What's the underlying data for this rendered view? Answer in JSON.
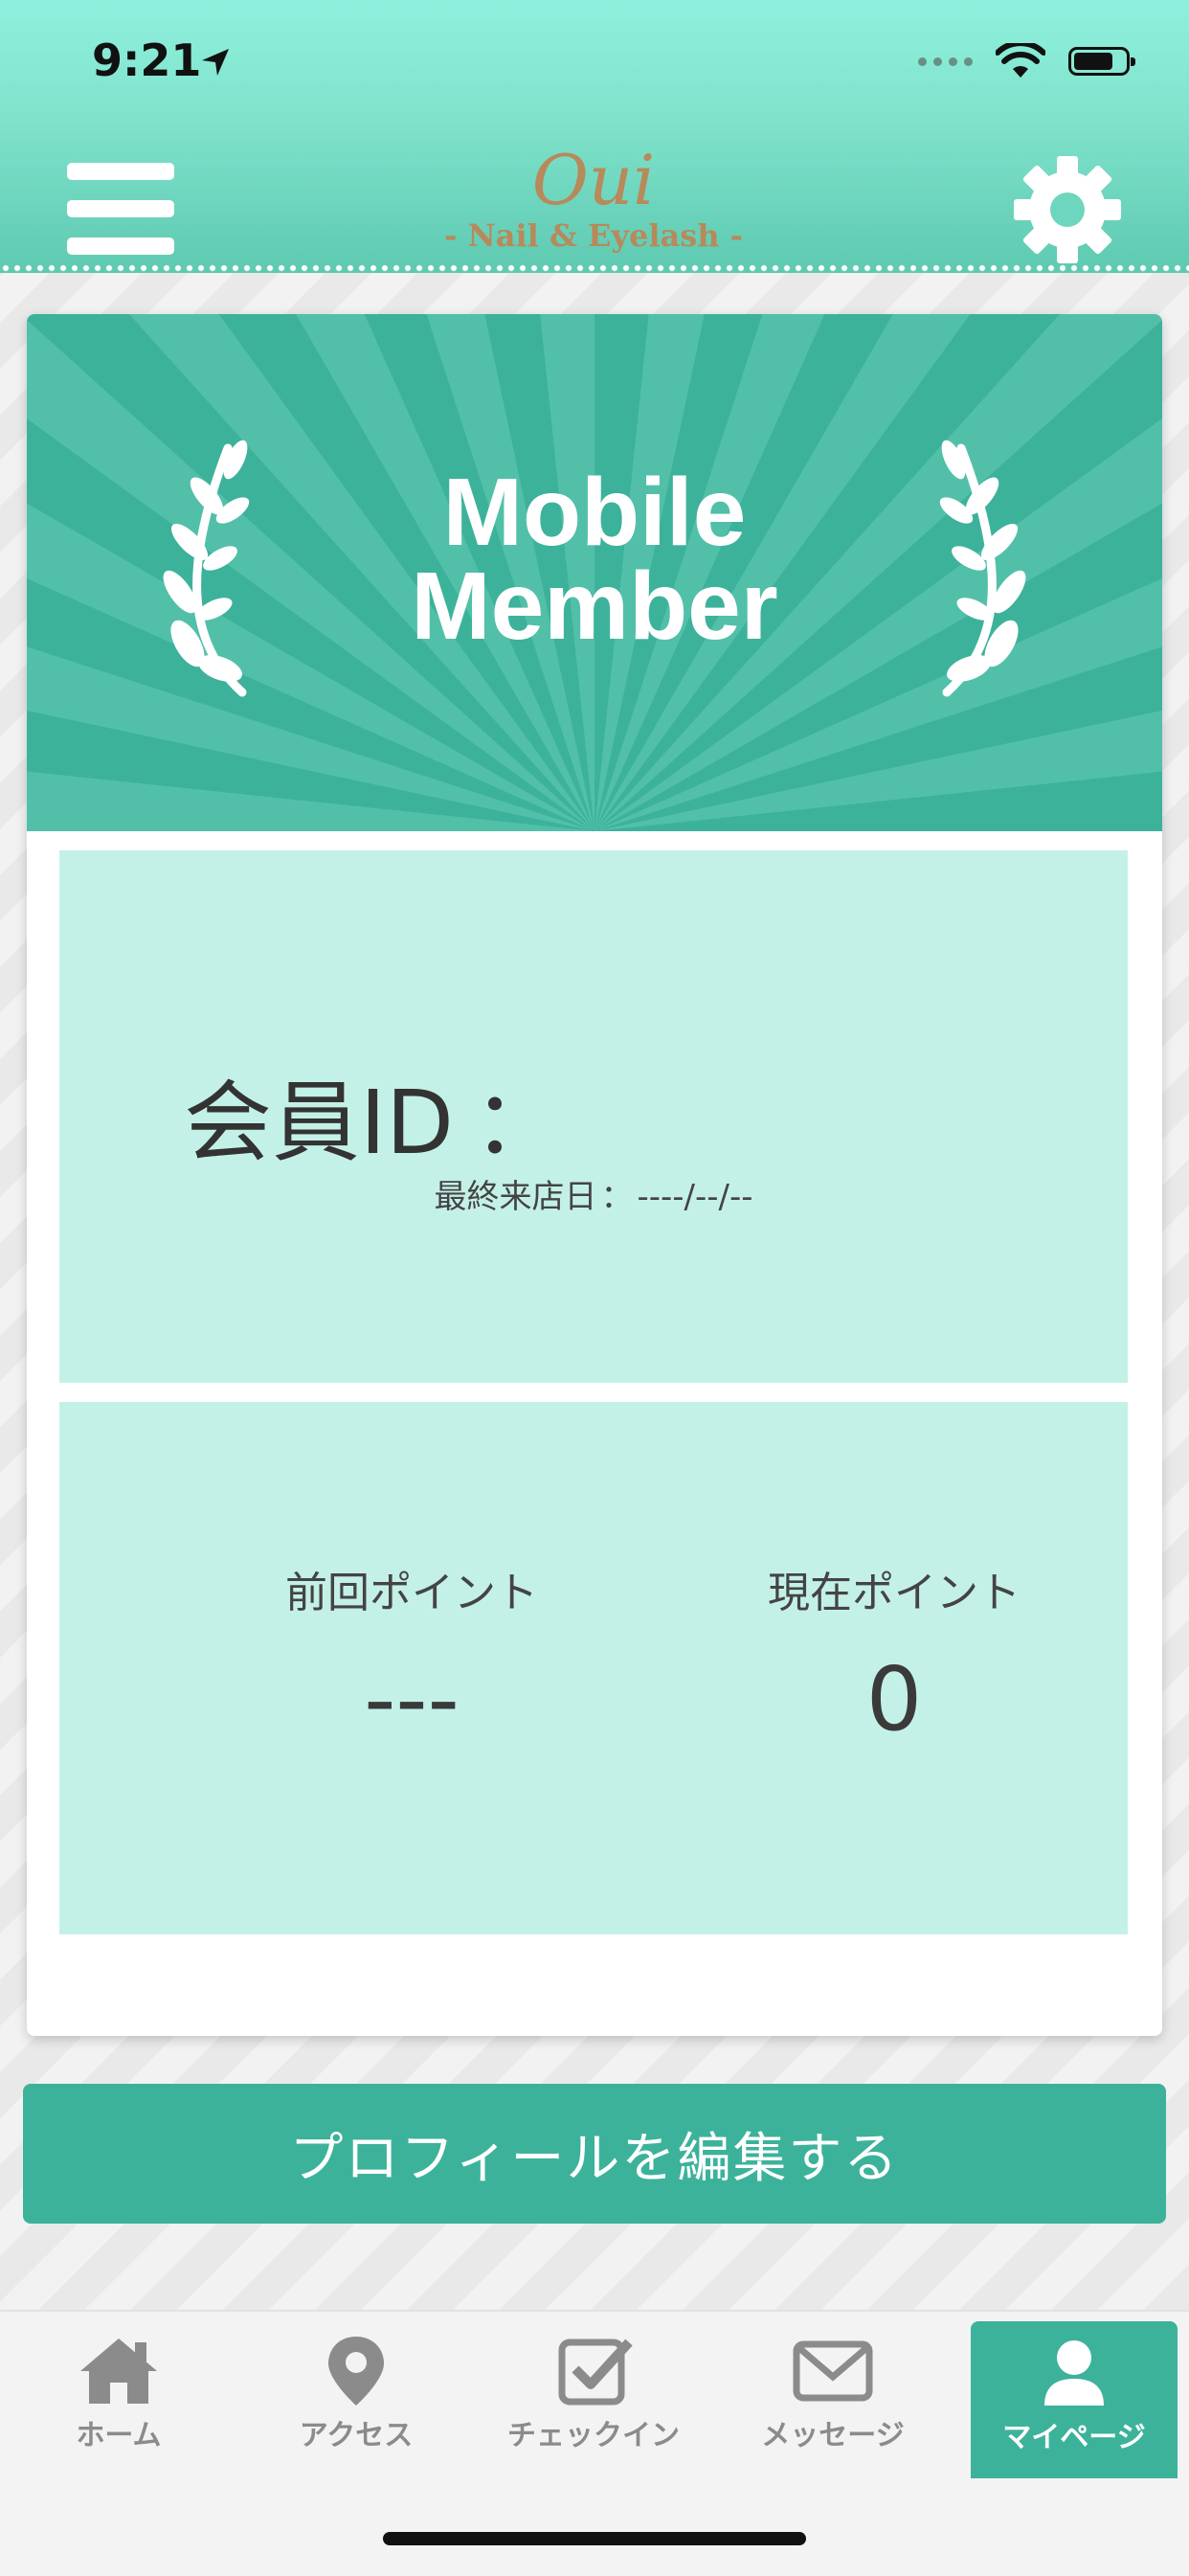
{
  "status_bar": {
    "time": "9:21"
  },
  "header": {
    "logo_main": "Oui",
    "logo_sub": "- Nail & Eyelash -",
    "menu_icon": "hamburger-icon",
    "settings_icon": "gear-icon"
  },
  "card": {
    "banner_line1": "Mobile",
    "banner_line2": "Member",
    "member_id_label": "会員ID",
    "member_id_colon": "：",
    "last_visit_label": "最終来店日",
    "last_visit_sep": "：",
    "last_visit_value": "----/--/--",
    "previous_points_label": "前回ポイント",
    "previous_points_value": "---",
    "current_points_label": "現在ポイント",
    "current_points_value": "0"
  },
  "edit_profile_label": "プロフィールを編集する",
  "tabs": [
    {
      "label": "ホーム",
      "icon": "home-icon"
    },
    {
      "label": "アクセス",
      "icon": "map-pin-icon"
    },
    {
      "label": "チェックイン",
      "icon": "checkbox-icon"
    },
    {
      "label": "メッセージ",
      "icon": "envelope-icon"
    },
    {
      "label": "マイページ",
      "icon": "user-icon",
      "active": true
    }
  ],
  "colors": {
    "accent": "#3db29b",
    "panel": "#c4f1e7",
    "header_top": "#8ff1dd",
    "logo": "#b8895a"
  }
}
